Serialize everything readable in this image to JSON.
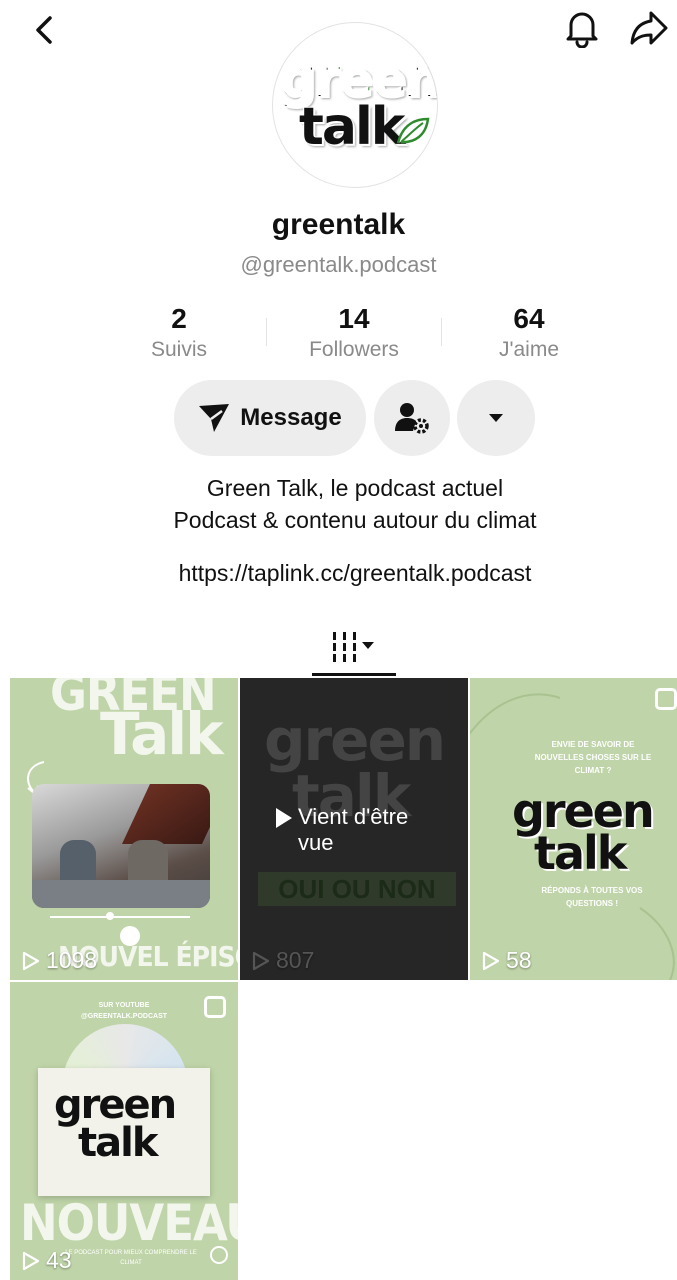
{
  "profile": {
    "display_name": "greentalk",
    "username": "@greentalk.podcast",
    "avatar_logo_line1": "green",
    "avatar_logo_line2": "talk"
  },
  "stats": [
    {
      "value": "2",
      "label": "Suivis"
    },
    {
      "value": "14",
      "label": "Followers"
    },
    {
      "value": "64",
      "label": "J'aime"
    }
  ],
  "actions": {
    "message_label": "Message"
  },
  "bio": {
    "line1": "Green Talk, le podcast actuel",
    "line2": "Podcast & contenu autour du climat",
    "link": "https://taplink.cc/greentalk.podcast"
  },
  "icons": {
    "back": "chevron-left-icon",
    "bell": "bell-icon",
    "share": "share-arrow-icon",
    "message": "paper-plane-icon",
    "user_settings": "user-gear-icon",
    "more": "caret-down-icon",
    "grid_tab": "grid-columns-icon"
  },
  "colors": {
    "accent_green": "#2e8b2e",
    "tile_green": "#bfd4a8",
    "tile_dark": "#262626",
    "button_gray": "#ededed",
    "muted_text": "#8a8a8a"
  },
  "videos": [
    {
      "count": "1098",
      "title_top": "GREEN",
      "title_big": "Talk",
      "caption": "NOUVEL ÉPISODE"
    },
    {
      "count": "807",
      "overlay": "Vient d'être vue",
      "logo1": "green",
      "logo2": "talk",
      "banner": "OUI OU NON"
    },
    {
      "count": "58",
      "question": "ENVIE DE SAVOIR DE NOUVELLES CHOSES SUR LE CLIMAT ?",
      "logo1": "green",
      "logo2": "talk",
      "answer": "RÉPONDS À TOUTES VOS QUESTIONS !"
    },
    {
      "count": "43",
      "top_line1": "SUR YOUTUBE",
      "top_line2": "@GREENTALK.PODCAST",
      "logo1": "green",
      "logo2": "talk",
      "big": "NOUVEAU",
      "bottom": "LE PODCAST POUR MIEUX COMPRENDRE LE CLIMAT"
    }
  ]
}
